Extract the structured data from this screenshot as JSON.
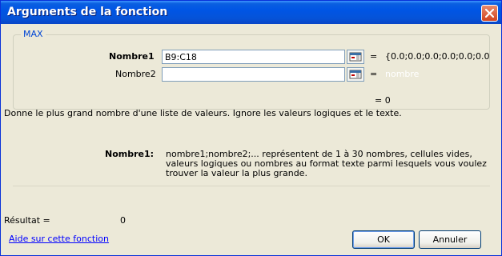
{
  "window": {
    "title": "Arguments de la fonction"
  },
  "function": {
    "name": "MAX"
  },
  "args": [
    {
      "label": "Nombre1",
      "value": "B9:C18",
      "result": "{0.0;0.0;0.0;0.0;0.0;0.0"
    },
    {
      "label": "Nombre2",
      "value": "",
      "result": "nombre"
    }
  ],
  "formula_result": "= 0",
  "description": "Donne le plus grand nombre d'une liste de valeurs. Ignore les valeurs logiques et le texte.",
  "arg_help": {
    "label": "Nombre1:",
    "line1": "nombre1;nombre2;... représentent de 1 à 30 nombres, cellules vides,",
    "line2": "valeurs logiques ou nombres au format texte parmi lesquels vous voulez",
    "line3": "trouver la valeur la plus grande."
  },
  "result": {
    "label": "Résultat =",
    "value": "0"
  },
  "help_link": "Aide sur cette fonction",
  "buttons": {
    "ok": "OK",
    "cancel": "Annuler"
  },
  "colors": {
    "titlebar": "#0055E5",
    "accent": "#0046D5",
    "link": "#0000FF",
    "close": "#D2431E"
  }
}
